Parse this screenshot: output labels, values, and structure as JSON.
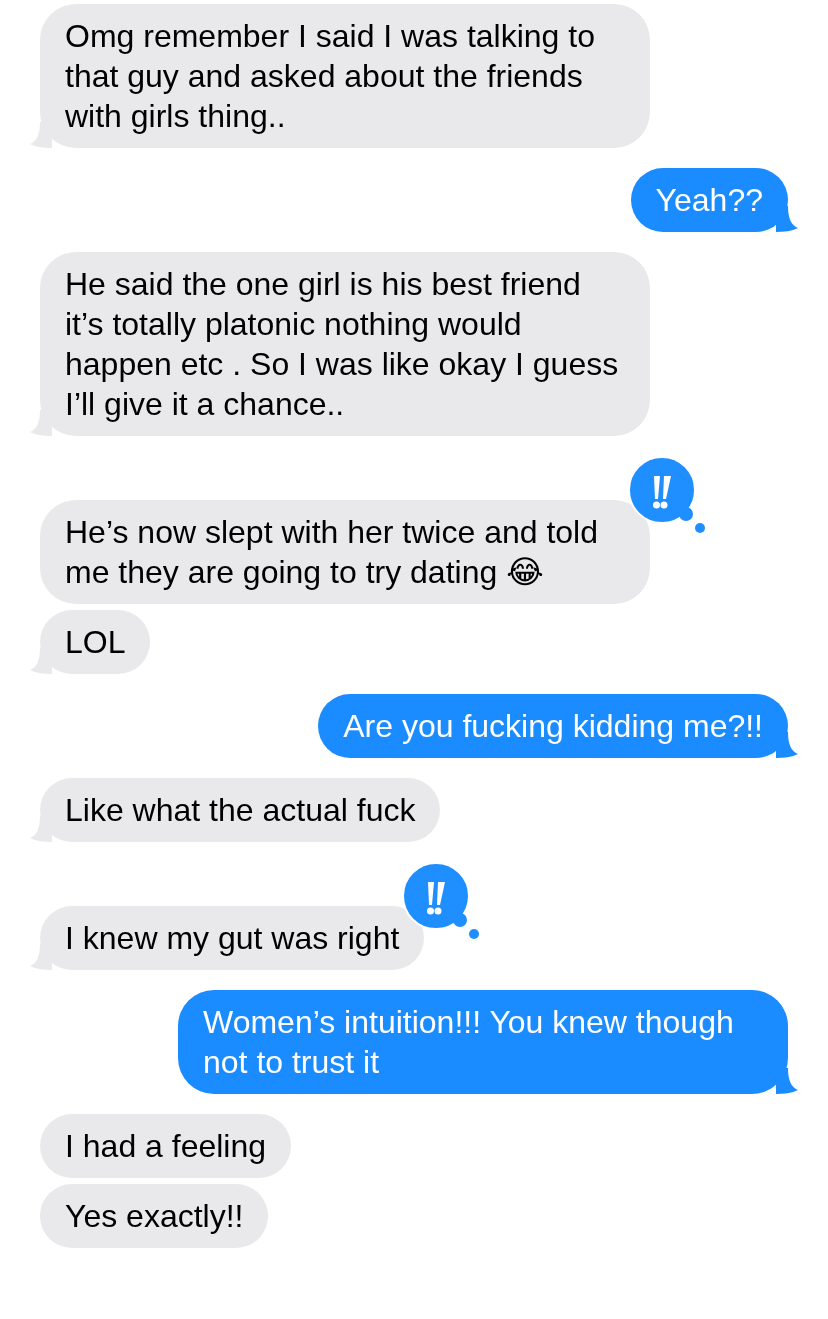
{
  "messages": [
    {
      "kind": "incoming",
      "text": "Omg remember I said I was talking to that guy and asked about the friends with girls thing..",
      "tail": true,
      "emphasized": false
    },
    {
      "kind": "outgoing",
      "text": "Yeah??",
      "tail": true,
      "emphasized": false
    },
    {
      "kind": "incoming",
      "text": "He said the one girl is his best friend it’s totally platonic nothing would happen etc . So I was like okay I guess I’ll give it a chance..",
      "tail": true,
      "emphasized": false
    },
    {
      "kind": "incoming",
      "text": "He’s now slept with her twice and told me they are going to try dating 😂",
      "tail": false,
      "emphasized": true
    },
    {
      "kind": "incoming",
      "text": "LOL",
      "tail": true,
      "emphasized": false
    },
    {
      "kind": "outgoing",
      "text": "Are you fucking kidding me?!!",
      "tail": true,
      "emphasized": false
    },
    {
      "kind": "incoming",
      "text": "Like what the actual fuck",
      "tail": true,
      "emphasized": false
    },
    {
      "kind": "incoming",
      "text": "I knew my gut was right",
      "tail": true,
      "emphasized": true
    },
    {
      "kind": "outgoing",
      "text": "Women’s intuition!!! You knew though not to trust it",
      "tail": true,
      "emphasized": false
    },
    {
      "kind": "incoming",
      "text": "I had a feeling",
      "tail": false,
      "emphasized": false
    },
    {
      "kind": "incoming",
      "text": "Yes exactly!!",
      "tail": false,
      "emphasized": false
    }
  ]
}
